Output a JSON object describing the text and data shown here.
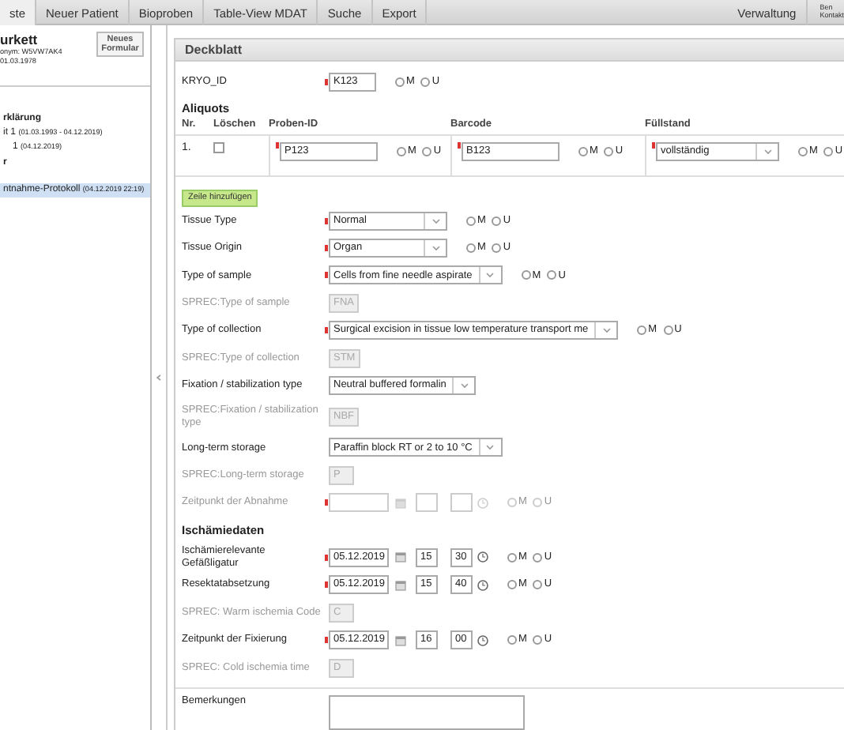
{
  "nav": {
    "items": [
      {
        "label": "ste",
        "selected": true
      },
      {
        "label": "Neuer Patient",
        "selected": false
      },
      {
        "label": "Bioproben",
        "selected": false
      },
      {
        "label": "Table-View MDAT",
        "selected": false
      },
      {
        "label": "Suche",
        "selected": false
      },
      {
        "label": "Export",
        "selected": false
      }
    ],
    "right_items": [
      "Verwaltung"
    ],
    "user_lines": [
      "Ben",
      "Kontakt"
    ]
  },
  "patient": {
    "name": "urkett",
    "pseudonym": "onym: W5VW7AK4",
    "birth_date": "01.03.1978",
    "new_form_button": "Neues Formular"
  },
  "tree": [
    {
      "label": "rklärung",
      "selected": false
    },
    {
      "label": "it 1",
      "date": "(01.03.1993 - 04.12.2019)",
      "selected": false,
      "children": [
        {
          "label": "1",
          "date": "(04.12.2019)",
          "selected": false
        }
      ]
    },
    {
      "label": "r",
      "selected": false
    },
    {
      "label": "ntnahme-Protokoll",
      "date": "(04.12.2019 22:19)",
      "selected": true
    }
  ],
  "form": {
    "title": "Deckblatt",
    "kryo_id": {
      "label": "KRYO_ID",
      "value": "K123",
      "required": true,
      "mu": [
        {
          "label": "M",
          "checked": false
        },
        {
          "label": "U",
          "checked": false
        }
      ]
    },
    "aliquots": {
      "title": "Aliquots",
      "columns": [
        "Nr.",
        "Löschen",
        "Proben-ID",
        "Barcode",
        "Füllstand"
      ],
      "rows": [
        {
          "nr": "1.",
          "delete_checked": false,
          "proben_id": {
            "value": "P123",
            "required": true,
            "mu": [
              {
                "label": "M",
                "checked": false
              },
              {
                "label": "U",
                "checked": false
              }
            ]
          },
          "barcode": {
            "value": "B123",
            "required": true,
            "mu": [
              {
                "label": "M",
                "checked": false
              },
              {
                "label": "U",
                "checked": false
              }
            ]
          },
          "fuellstand": {
            "value": "vollständig",
            "required": true,
            "mu": [
              {
                "label": "M",
                "checked": false
              },
              {
                "label": "U",
                "checked": false
              }
            ]
          }
        }
      ],
      "add_row_button": "Zeile hinzufügen"
    },
    "fields": [
      {
        "kind": "select",
        "label": "Tissue Type",
        "value": "Normal",
        "required": true,
        "mu": [
          {
            "label": "M",
            "checked": false
          },
          {
            "label": "U",
            "checked": false
          }
        ]
      },
      {
        "kind": "select",
        "label": "Tissue Origin",
        "value": "Organ",
        "required": true,
        "mu": [
          {
            "label": "M",
            "checked": false
          },
          {
            "label": "U",
            "checked": false
          }
        ]
      },
      {
        "kind": "select",
        "label": "Type of sample",
        "value": "Cells from fine needle aspirate",
        "required": true,
        "mu": [
          {
            "label": "M",
            "checked": false
          },
          {
            "label": "U",
            "checked": false
          }
        ]
      },
      {
        "kind": "sprec",
        "label": "SPREC:Type of sample",
        "value": "FNA"
      },
      {
        "kind": "select",
        "label": "Type of collection",
        "value": "Surgical excision in tissue low temperature transport me",
        "required": true,
        "mu": [
          {
            "label": "M",
            "checked": false
          },
          {
            "label": "U",
            "checked": false
          }
        ]
      },
      {
        "kind": "sprec",
        "label": "SPREC:Type of collection",
        "value": "STM"
      },
      {
        "kind": "select",
        "label": "Fixation / stabilization type",
        "value": "Neutral buffered formalin",
        "required": false
      },
      {
        "kind": "sprec",
        "label": "SPREC:Fixation / stabilization type",
        "value": "NBF"
      },
      {
        "kind": "select",
        "label": "Long-term storage",
        "value": "Paraffin block RT or 2 to 10 °C",
        "required": false
      },
      {
        "kind": "sprec",
        "label": "SPREC:Long-term storage",
        "value": "P"
      },
      {
        "kind": "datetime",
        "label": "Zeitpunkt der Abnahme",
        "disabled": true,
        "required": true,
        "mu": [
          {
            "label": "M",
            "checked": false
          },
          {
            "label": "U",
            "checked": false
          }
        ]
      },
      {
        "kind": "heading",
        "label": "Ischämiedaten"
      },
      {
        "kind": "datetime",
        "label": "Ischämierelevante Gefäßligatur",
        "disabled": false,
        "required": true,
        "date": "05.12.2019",
        "hour": "15",
        "minute": "30",
        "mu": [
          {
            "label": "M",
            "checked": false
          },
          {
            "label": "U",
            "checked": false
          }
        ]
      },
      {
        "kind": "datetime",
        "label": "Resektatabsetzung",
        "disabled": false,
        "required": true,
        "date": "05.12.2019",
        "hour": "15",
        "minute": "40",
        "mu": [
          {
            "label": "M",
            "checked": false
          },
          {
            "label": "U",
            "checked": false
          }
        ]
      },
      {
        "kind": "sprec",
        "label": "SPREC: Warm ischemia Code",
        "value": "C"
      },
      {
        "kind": "datetime",
        "label": "Zeitpunkt der Fixierung",
        "disabled": false,
        "required": true,
        "date": "05.12.2019",
        "hour": "16",
        "minute": "00",
        "mu": [
          {
            "label": "M",
            "checked": false
          },
          {
            "label": "U",
            "checked": false
          }
        ]
      },
      {
        "kind": "sprec",
        "label": "SPREC: Cold ischemia time",
        "value": "D"
      },
      {
        "kind": "textarea",
        "label": "Bemerkungen"
      }
    ]
  }
}
